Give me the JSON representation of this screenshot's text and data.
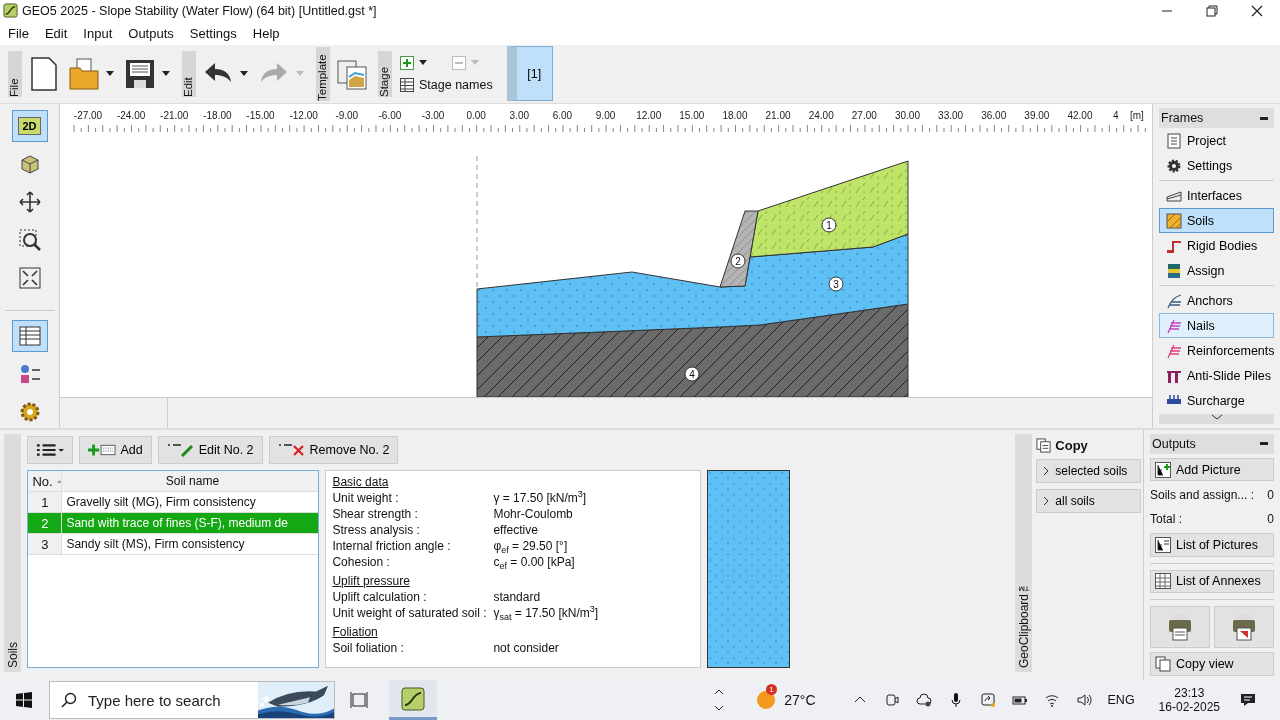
{
  "window": {
    "title": "GEO5 2025 - Slope Stability (Water Flow) (64 bit) [Untitled.gst *]"
  },
  "menu": [
    "File",
    "Edit",
    "Input",
    "Outputs",
    "Settings",
    "Help"
  ],
  "toolbar": {
    "file_label": "File",
    "edit_label": "Edit",
    "template_label": "Template",
    "stage_label": "Stage",
    "stage_names": "Stage names",
    "stages": [
      {
        "label": "[1]",
        "selected": true
      }
    ]
  },
  "left_tools": [
    {
      "kind": "flat",
      "label": "2D",
      "selected": true
    },
    {
      "kind": "cube",
      "selected": false
    },
    {
      "kind": "move",
      "selected": false
    },
    {
      "kind": "zoom",
      "selected": false
    },
    {
      "kind": "fit",
      "selected": false
    },
    {
      "kind": "table",
      "selected": true
    },
    {
      "kind": "legend",
      "selected": false
    },
    {
      "kind": "settings",
      "selected": false
    }
  ],
  "ruler": {
    "ticks": [
      "-27.00",
      "-24.00",
      "-21.00",
      "-18.00",
      "-15.00",
      "-12.00",
      "-9.00",
      "-6.00",
      "-3.00",
      "0.00",
      "3.00",
      "6.00",
      "9.00",
      "12.00",
      "15.00",
      "18.00",
      "21.00",
      "24.00",
      "27.00",
      "30.00",
      "33.00",
      "36.00",
      "39.00",
      "42.00",
      "4"
    ],
    "unit": "[m]"
  },
  "canvas": {
    "region_labels": [
      "1",
      "2",
      "3",
      "4"
    ]
  },
  "frames": {
    "title": "Frames",
    "groups": [
      [
        {
          "kind": "project",
          "label": "Project",
          "selected": false,
          "hovered": false
        },
        {
          "kind": "settings",
          "label": "Settings",
          "selected": false,
          "hovered": false
        }
      ],
      [
        {
          "kind": "interfaces",
          "label": "Interfaces",
          "selected": false,
          "hovered": false
        },
        {
          "kind": "soils",
          "label": "Soils",
          "selected": true,
          "hovered": false
        },
        {
          "kind": "rigid",
          "label": "Rigid Bodies",
          "selected": false,
          "hovered": false
        },
        {
          "kind": "assign",
          "label": "Assign",
          "selected": false,
          "hovered": false
        }
      ],
      [
        {
          "kind": "anchors",
          "label": "Anchors",
          "selected": false,
          "hovered": false
        },
        {
          "kind": "nails",
          "label": "Nails",
          "selected": false,
          "hovered": true
        },
        {
          "kind": "reinforcements",
          "label": "Reinforcements",
          "selected": false,
          "hovered": false
        },
        {
          "kind": "piles",
          "label": "Anti-Slide Piles",
          "selected": false,
          "hovered": false
        },
        {
          "kind": "surcharge",
          "label": "Surcharge",
          "selected": false,
          "hovered": false
        }
      ]
    ]
  },
  "soils_panel": {
    "side_label": "Soils",
    "buttons": {
      "add": "Add",
      "edit": "Edit No. 2",
      "remove": "Remove No. 2"
    },
    "columns": [
      "No.",
      "Soil name"
    ],
    "rows": [
      {
        "no": "1",
        "name": "Gravelly silt (MG), Firm consistency",
        "selected": false
      },
      {
        "no": "2",
        "name": "Sand with trace of fines (S-F), medium de",
        "selected": true
      },
      {
        "no": "3",
        "name": "Sandy silt (MS), Firm consistency",
        "selected": false
      }
    ],
    "details": [
      {
        "heading": "Basic data",
        "rows": [
          {
            "label": "Unit weight :",
            "value": "γ = 17.50 [kN/m$^{3}$]"
          },
          {
            "label": "Shear strength :",
            "value": "Mohr-Coulomb"
          },
          {
            "label": "Stress analysis :",
            "value": "effective"
          },
          {
            "label": "Internal friction angle :",
            "value": "φ$_{ef}$ = 29.50 [°]"
          },
          {
            "label": "Cohesion :",
            "value": "c$_{ef}$ = 0.00 [kPa]"
          }
        ]
      },
      {
        "heading": "Uplift pressure",
        "rows": [
          {
            "label": "Uplift calculation :",
            "value": "standard"
          },
          {
            "label": "Unit weight of saturated soil :",
            "value": "γ$_{sat}$ = 17.50 [kN/m$^{3}$]"
          }
        ]
      },
      {
        "heading": "Foliation",
        "rows": [
          {
            "label": "Soil foliation :",
            "value": "not consider"
          }
        ]
      }
    ]
  },
  "clipboard": {
    "side_label": "GeoClipboard™",
    "title": "Copy",
    "buttons": [
      "selected soils",
      "all soils"
    ]
  },
  "outputs": {
    "title": "Outputs",
    "add_picture": "Add Picture",
    "counts": [
      {
        "label": "Soils and assign... :",
        "value": "0"
      },
      {
        "label": "Total :",
        "value": "0"
      }
    ],
    "list_pictures": "List of Pictures",
    "list_annexes": "List of Annexes",
    "copy_view": "Copy view"
  },
  "taskbar": {
    "search_placeholder": "Type here to search",
    "weather_badge": "1",
    "temperature": "27°C",
    "language": "ENG",
    "time": "23:13",
    "date": "16-02-2025"
  }
}
